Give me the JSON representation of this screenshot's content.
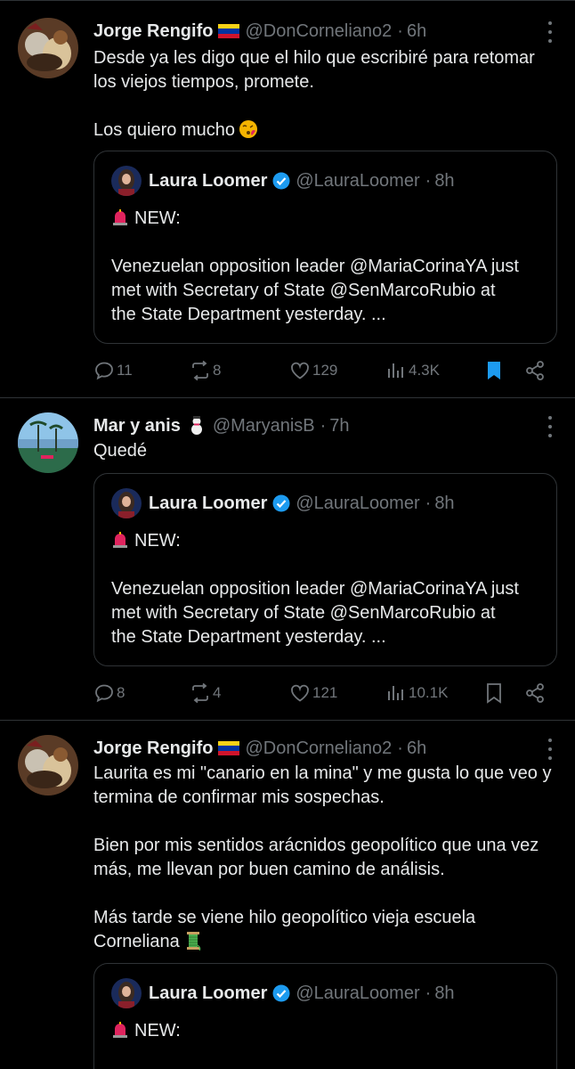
{
  "colors": {
    "background": "#000000",
    "text": "#e7e9ea",
    "muted": "#71767b",
    "border": "#2f3336",
    "accent": "#1d9bf0"
  },
  "quoted": {
    "name": "Laura Loomer",
    "handle": "@LauraLoomer",
    "time": "8h",
    "new_label": "NEW:",
    "text_1": "Venezuelan opposition leader @MariaCorinaYA just",
    "text_2": "met with Secretary of State @SenMarcoRubio at",
    "text_3": "the State Department yesterday. ..."
  },
  "tweets": [
    {
      "name": "Jorge Rengifo",
      "flag_icon": "venezuela-flag-icon",
      "handle": "@DonCorneliano2",
      "time": "6h",
      "line_1": "Desde ya les digo que el hilo que escribiré para retomar",
      "line_2": "los viejos tiempos, promete.",
      "line_3": "Los quiero mucho",
      "emoji": "kissing-face-icon",
      "replies": "11",
      "reposts": "8",
      "likes": "129",
      "views": "4.3K",
      "bookmarked": true
    },
    {
      "name": "Mar y anis",
      "name_emoji": "snowman-icon",
      "handle": "@MaryanisB",
      "time": "7h",
      "line_1": "Quedé",
      "replies": "8",
      "reposts": "4",
      "likes": "121",
      "views": "10.1K",
      "bookmarked": false
    },
    {
      "name": "Jorge Rengifo",
      "flag_icon": "venezuela-flag-icon",
      "handle": "@DonCorneliano2",
      "time": "6h",
      "line_1": "Laurita es mi \"canario en la mina\" y me gusta lo que veo y",
      "line_2": "termina de confirmar mis sospechas.",
      "line_3": "Bien por mis sentidos arácnidos geopolítico que una vez",
      "line_4": "más, me llevan por buen camino de análisis.",
      "line_5": "Más tarde se viene hilo geopolítico vieja escuela",
      "line_6": "Corneliana",
      "emoji": "thread-spool-icon"
    }
  ]
}
